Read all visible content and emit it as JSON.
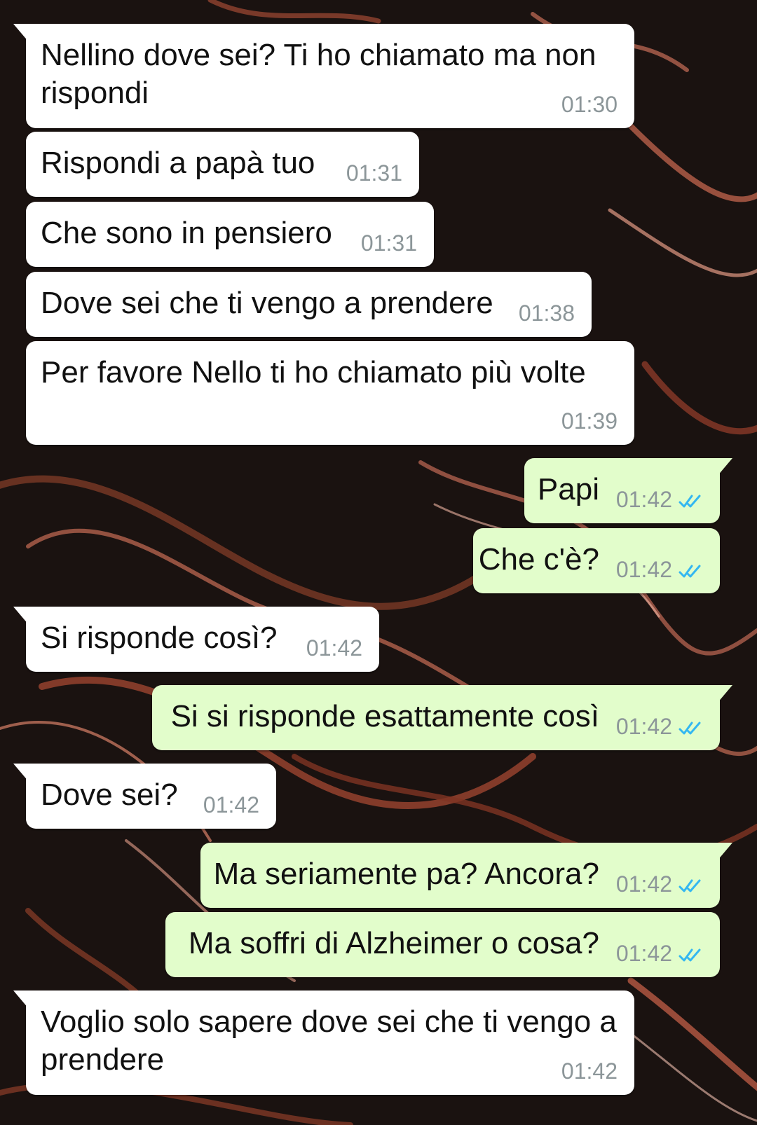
{
  "conversation": {
    "messages": [
      {
        "dir": "in",
        "text": "Nellino dove sei? Ti ho chiamato ma non\nrispondi",
        "time": "01:30",
        "tail": true
      },
      {
        "dir": "in",
        "text": "Rispondi a papà tuo",
        "time": "01:31",
        "tail": false
      },
      {
        "dir": "in",
        "text": "Che sono in pensiero",
        "time": "01:31",
        "tail": false
      },
      {
        "dir": "in",
        "text": "Dove sei che ti vengo a prendere",
        "time": "01:38",
        "tail": false
      },
      {
        "dir": "in",
        "text": "Per favore Nello ti ho chiamato più volte",
        "time": "01:39",
        "tail": false
      },
      {
        "dir": "out",
        "text": "Papi",
        "time": "01:42",
        "tail": true,
        "read": true
      },
      {
        "dir": "out",
        "text": "Che c'è?",
        "time": "01:42",
        "tail": false,
        "read": true
      },
      {
        "dir": "in",
        "text": "Si risponde così?",
        "time": "01:42",
        "tail": true
      },
      {
        "dir": "out",
        "text": "Si si risponde esattamente così",
        "time": "01:42",
        "tail": true,
        "read": true
      },
      {
        "dir": "in",
        "text": "Dove sei?",
        "time": "01:42",
        "tail": true
      },
      {
        "dir": "out",
        "text": "Ma seriamente pa? Ancora?",
        "time": "01:42",
        "tail": true,
        "read": true
      },
      {
        "dir": "out",
        "text": "Ma soffri di Alzheimer o cosa?",
        "time": "01:42",
        "tail": false,
        "read": true
      },
      {
        "dir": "in",
        "text": "Voglio solo sapere dove sei che ti vengo a\nprendere",
        "time": "01:42",
        "tail": true
      }
    ]
  },
  "colors": {
    "incoming_bubble": "#ffffff",
    "outgoing_bubble": "#e2fdcb",
    "timestamp": "#8c9699",
    "read_ticks": "#34b7f1",
    "wallpaper_base": "#1a1210"
  },
  "icons": {
    "read_receipt": "double-check-icon"
  }
}
